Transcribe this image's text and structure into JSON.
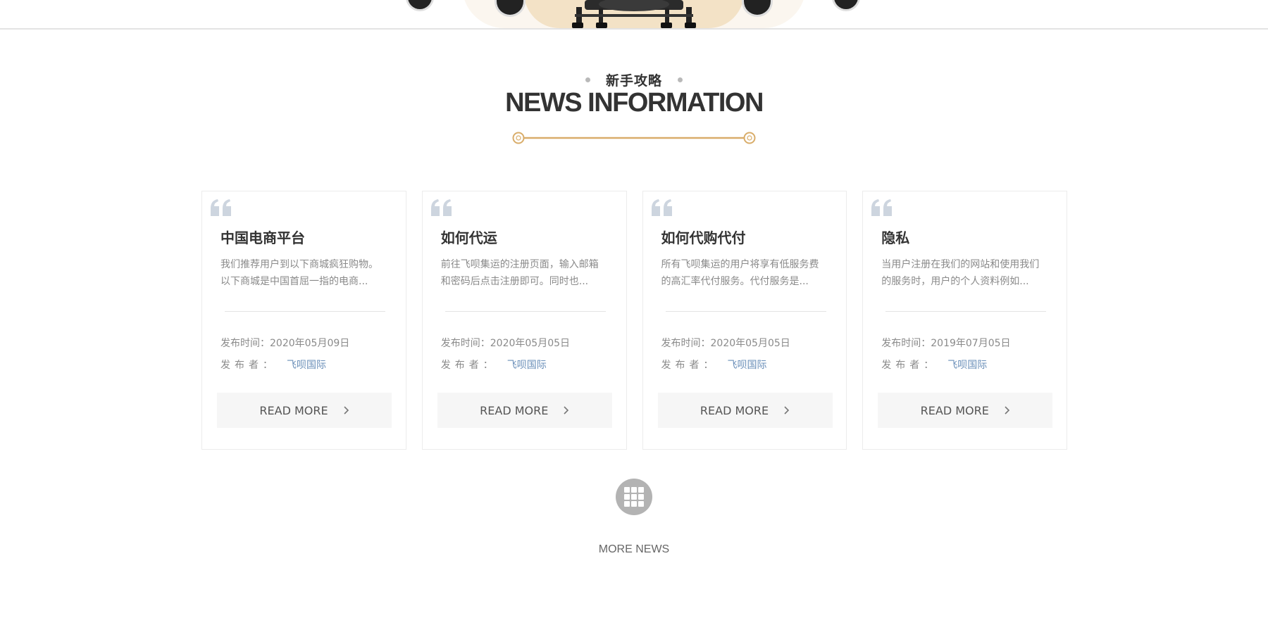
{
  "section": {
    "subtitle": "新手攻略",
    "title": "NEWS INFORMATION"
  },
  "colors": {
    "accent": "#d9ad6a",
    "author_link": "#6a8fb9",
    "quote_icon": "#cdd5df"
  },
  "cards": [
    {
      "title": "中国电商平台",
      "desc_line1": "我们推荐用户到以下商城疯狂购物。",
      "desc_line2": "以下商城是中国首屈一指的电商...",
      "date": "发布时间：2020年05月09日",
      "author_label": "发布者：",
      "author": "飞呗国际",
      "read_more": "READ MORE"
    },
    {
      "title": "如何代运",
      "desc_line1": "前往飞呗集运的注册页面，输入邮箱",
      "desc_line2": "和密码后点击注册即可。同时也...",
      "date": "发布时间：2020年05月05日",
      "author_label": "发布者：",
      "author": "飞呗国际",
      "read_more": "READ MORE"
    },
    {
      "title": "如何代购代付",
      "desc_line1": "所有飞呗集运的用户将享有低服务费",
      "desc_line2": "的高汇率代付服务。代付服务是...",
      "date": "发布时间：2020年05月05日",
      "author_label": "发布者：",
      "author": "飞呗国际",
      "read_more": "READ MORE"
    },
    {
      "title": "隐私",
      "desc_line1": "当用户注册在我们的网站和使用我们",
      "desc_line2": "的服务时，用户的个人资料例如...",
      "date": "发布时间：2019年07月05日",
      "author_label": "发布者：",
      "author": "飞呗国际",
      "read_more": "READ MORE"
    }
  ],
  "more_news": {
    "label": "MORE NEWS",
    "icon": "grid-icon"
  }
}
